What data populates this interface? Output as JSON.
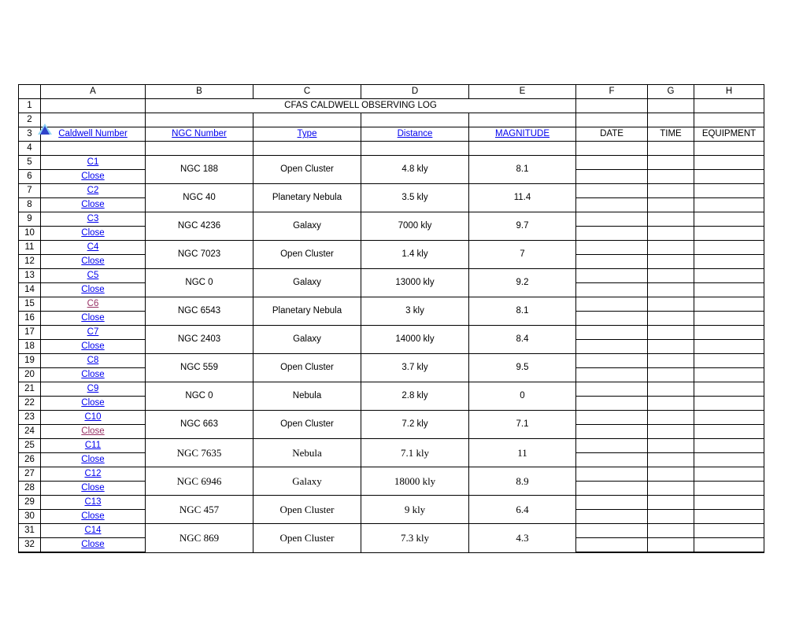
{
  "sheet": {
    "title": "CFAS CALDWELL OBSERVING LOG",
    "column_headers": [
      "A",
      "B",
      "C",
      "D",
      "E",
      "F",
      "G",
      "H"
    ],
    "row_numbers": [
      "1",
      "2",
      "3",
      "4",
      "5",
      "6",
      "7",
      "8",
      "9",
      "10",
      "11",
      "12",
      "13",
      "14",
      "15",
      "16",
      "17",
      "18",
      "19",
      "20",
      "21",
      "22",
      "23",
      "24",
      "25",
      "26",
      "27",
      "28",
      "29",
      "30",
      "31",
      "32"
    ],
    "marker_icon": "blue-triangle-marker"
  },
  "headers": {
    "caldwell_number": "Caldwell Number ",
    "ngc_number": "NGC Number",
    "type": "Type",
    "distance": "Distance",
    "magnitude": " MAGNITUDE",
    "date": "DATE",
    "time": "TIME",
    "equipment": "EQUIPMENT"
  },
  "link_labels": {
    "close": "Close"
  },
  "colors": {
    "link": "#0000ee",
    "visited_link": "#993366",
    "marker": "#3a53d6",
    "grid_line": "#000000",
    "block_separator": "#808080"
  },
  "entries": [
    {
      "id_row": "5",
      "close_row": "6",
      "caldwell": "C1",
      "caldwell_visited": false,
      "close_visited": false,
      "ngc": "NGC 188",
      "type": "Open Cluster",
      "distance": "4.8 kly",
      "magnitude": "8.1",
      "date": "",
      "time": "",
      "equipment": "",
      "serif": false
    },
    {
      "id_row": "7",
      "close_row": "8",
      "caldwell": "C2",
      "caldwell_visited": false,
      "close_visited": false,
      "ngc": "NGC 40",
      "type": "Planetary Nebula",
      "distance": "3.5 kly",
      "magnitude": "11.4",
      "date": "",
      "time": "",
      "equipment": "",
      "serif": false
    },
    {
      "id_row": "9",
      "close_row": "10",
      "caldwell": "C3",
      "caldwell_visited": false,
      "close_visited": false,
      "ngc": "NGC 4236",
      "type": "Galaxy",
      "distance": "7000 kly",
      "magnitude": "9.7",
      "date": "",
      "time": "",
      "equipment": "",
      "serif": false
    },
    {
      "id_row": "11",
      "close_row": "12",
      "caldwell": "C4",
      "caldwell_visited": false,
      "close_visited": false,
      "ngc": "NGC 7023",
      "type": "Open Cluster",
      "distance": "1.4 kly",
      "magnitude": "7",
      "date": "",
      "time": "",
      "equipment": "",
      "serif": false
    },
    {
      "id_row": "13",
      "close_row": "14",
      "caldwell": "C5",
      "caldwell_visited": false,
      "close_visited": false,
      "ngc": "NGC 0",
      "type": "Galaxy",
      "distance": "13000 kly",
      "magnitude": "9.2",
      "date": "",
      "time": "",
      "equipment": "",
      "serif": false
    },
    {
      "id_row": "15",
      "close_row": "16",
      "caldwell": "C6",
      "caldwell_visited": true,
      "close_visited": false,
      "ngc": "NGC 6543",
      "type": "Planetary Nebula",
      "distance": "3 kly",
      "magnitude": "8.1",
      "date": "",
      "time": "",
      "equipment": "",
      "serif": false
    },
    {
      "id_row": "17",
      "close_row": "18",
      "caldwell": "C7",
      "caldwell_visited": false,
      "close_visited": false,
      "ngc": "NGC 2403",
      "type": "Galaxy",
      "distance": "14000 kly",
      "magnitude": "8.4",
      "date": "",
      "time": "",
      "equipment": "",
      "serif": false
    },
    {
      "id_row": "19",
      "close_row": "20",
      "caldwell": "C8",
      "caldwell_visited": false,
      "close_visited": false,
      "ngc": "NGC 559",
      "type": "Open Cluster",
      "distance": "3.7 kly",
      "magnitude": "9.5",
      "date": "",
      "time": "",
      "equipment": "",
      "serif": false
    },
    {
      "id_row": "21",
      "close_row": "22",
      "caldwell": "C9",
      "caldwell_visited": false,
      "close_visited": false,
      "ngc": "NGC 0",
      "type": "Nebula",
      "distance": "2.8 kly",
      "magnitude": "0",
      "date": "",
      "time": "",
      "equipment": "",
      "serif": false
    },
    {
      "id_row": "23",
      "close_row": "24",
      "caldwell": "C10",
      "caldwell_visited": false,
      "close_visited": true,
      "ngc": "NGC 663",
      "type": "Open Cluster",
      "distance": "7.2 kly",
      "magnitude": "7.1",
      "date": "",
      "time": "",
      "equipment": "",
      "serif": false
    },
    {
      "id_row": "25",
      "close_row": "26",
      "caldwell": "C11",
      "caldwell_visited": false,
      "close_visited": false,
      "ngc": "NGC 7635",
      "type": "Nebula",
      "distance": "7.1 kly",
      "magnitude": "11",
      "date": "",
      "time": "",
      "equipment": "",
      "serif": true
    },
    {
      "id_row": "27",
      "close_row": "28",
      "caldwell": "C12",
      "caldwell_visited": false,
      "close_visited": false,
      "ngc": "NGC 6946",
      "type": "Galaxy",
      "distance": "18000 kly",
      "magnitude": "8.9",
      "date": "",
      "time": "",
      "equipment": "",
      "serif": true
    },
    {
      "id_row": "29",
      "close_row": "30",
      "caldwell": "C13",
      "caldwell_visited": false,
      "close_visited": false,
      "ngc": "NGC 457",
      "type": "Open Cluster",
      "distance": "9 kly",
      "magnitude": "6.4",
      "date": "",
      "time": "",
      "equipment": "",
      "serif": true
    },
    {
      "id_row": "31",
      "close_row": "32",
      "caldwell": "C14",
      "caldwell_visited": false,
      "close_visited": false,
      "ngc": "NGC 869",
      "type": "Open Cluster",
      "distance": "7.3 kly",
      "magnitude": "4.3",
      "date": "",
      "time": "",
      "equipment": "",
      "serif": true
    }
  ]
}
